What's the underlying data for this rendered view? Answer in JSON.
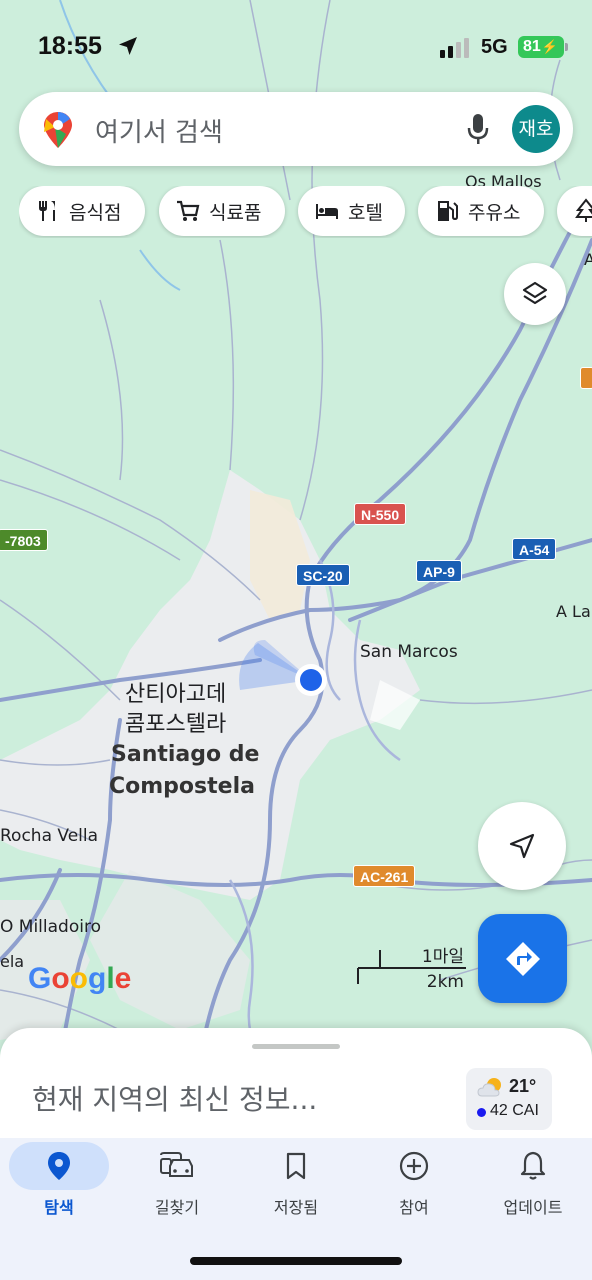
{
  "status_bar": {
    "time": "18:55",
    "network": "5G",
    "battery": "81"
  },
  "search": {
    "placeholder": "여기서 검색",
    "avatar_text": "재호"
  },
  "chips": [
    {
      "label": "음식점",
      "icon": "fork-knife-icon"
    },
    {
      "label": "식료품",
      "icon": "cart-icon"
    },
    {
      "label": "호텔",
      "icon": "bed-icon"
    },
    {
      "label": "주유소",
      "icon": "gas-pump-icon"
    },
    {
      "label": "",
      "icon": "tree-icon"
    }
  ],
  "map": {
    "city_label_ko_1": "산티아고데",
    "city_label_ko_2": "콤포스텔라",
    "city_label_en_1": "Santiago de",
    "city_label_en_2": "Compostela",
    "places": [
      "Os Mallos",
      "San Marcos",
      "A La",
      "Rocha Vella",
      "O Milladoiro",
      "ela"
    ],
    "roads": [
      "N-550",
      "SC-20",
      "AP-9",
      "A-54",
      "AC-261",
      "-7803",
      "A"
    ],
    "road_colors": {
      "national": "#d9534f",
      "highway": "#1a5fb4",
      "regional": "#e08a2c",
      "local": "#4d8a2a"
    },
    "scale_miles": "1마일",
    "scale_km": "2km",
    "logo": "Google"
  },
  "sheet": {
    "title": "현재 지역의 최신 정보...",
    "weather_temp": "21°",
    "air_quality": "42 CAI"
  },
  "nav": [
    {
      "label": "탐색",
      "icon": "explore-pin-icon",
      "active": true
    },
    {
      "label": "길찾기",
      "icon": "commute-car-icon",
      "active": false
    },
    {
      "label": "저장됨",
      "icon": "bookmark-icon",
      "active": false
    },
    {
      "label": "참여",
      "icon": "add-circle-icon",
      "active": false
    },
    {
      "label": "업데이트",
      "icon": "bell-icon",
      "active": false
    }
  ],
  "colors": {
    "accent": "#1a73e8",
    "map_bg": "#cfeedd",
    "active_tab": "#cfe0fb"
  }
}
